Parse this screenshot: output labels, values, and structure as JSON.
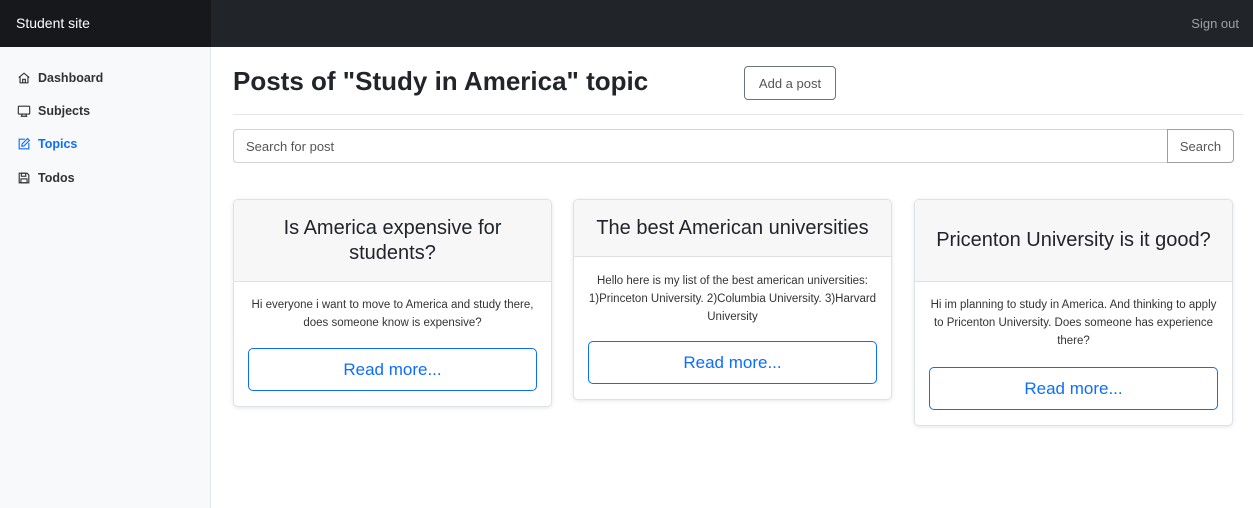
{
  "navbar": {
    "brand": "Student site",
    "signout_label": "Sign out"
  },
  "sidebar": {
    "items": [
      {
        "label": "Dashboard",
        "icon": "home-icon",
        "active": false
      },
      {
        "label": "Subjects",
        "icon": "monitor-icon",
        "active": false
      },
      {
        "label": "Topics",
        "icon": "edit-icon",
        "active": true
      },
      {
        "label": "Todos",
        "icon": "save-icon",
        "active": false
      }
    ]
  },
  "main": {
    "title": "Posts of \"Study in America\" topic",
    "add_post_label": "Add a post",
    "search": {
      "placeholder": "Search for post",
      "value": "",
      "button_label": "Search"
    },
    "posts": [
      {
        "title": "Is America expensive for students?",
        "body": "Hi everyone i want to move to America and study there, does someone know is expensive?",
        "button_label": "Read more..."
      },
      {
        "title": "The best American universities",
        "body": "Hello here is my list of the best american universities: 1)Princeton University. 2)Columbia University. 3)Harvard University",
        "button_label": "Read more..."
      },
      {
        "title": "Pricenton University is it good?",
        "body": "Hi im planning to study in America. And thinking to apply to Pricenton University. Does someone has experience there?",
        "button_label": "Read more..."
      }
    ]
  },
  "colors": {
    "navbar": "#212529",
    "brand_bg": "#16181b",
    "accent": "#0d6efd",
    "sidebar_bg": "#f8f9fa"
  }
}
